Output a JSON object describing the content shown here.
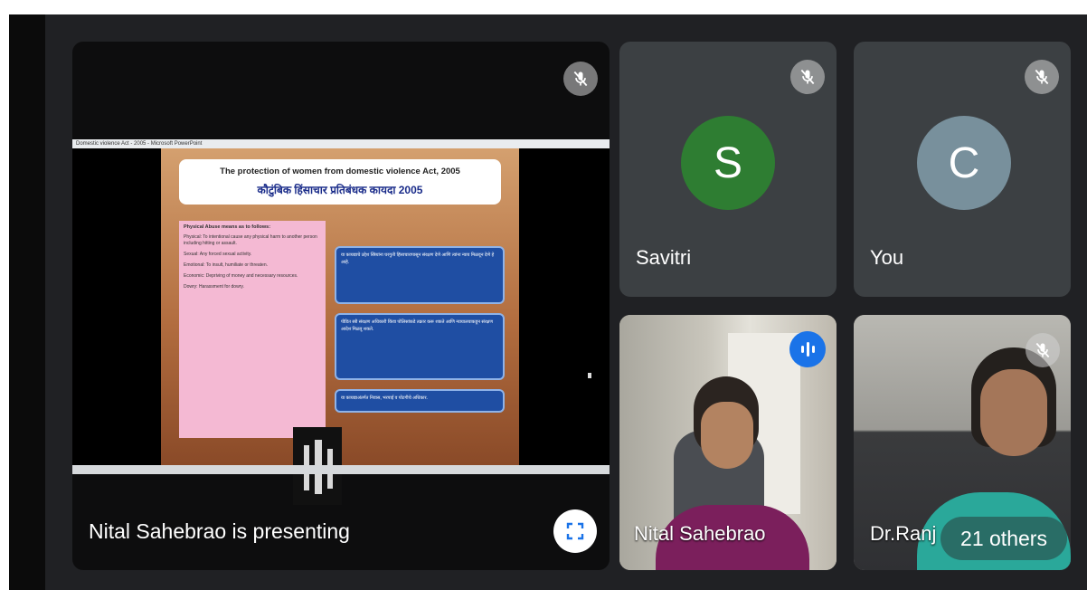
{
  "presentation": {
    "status_text": "Nital Sahebrao is presenting",
    "window_title": "Domestic violence Act - 2005 - Microsoft PowerPoint",
    "slide": {
      "title_en": "The protection of women from domestic violence Act, 2005",
      "title_mr": "कौटुंबिक हिंसाचार प्रतिबंधक कायदा 2005",
      "pink_heading": "Physical Abuse means as to follows:",
      "pink_points": [
        "Physical: To intentional cause any physical harm to another person including hitting or assault.",
        "Sexual: Any forced sexual activity.",
        "Emotional: To insult, humiliate or threaten.",
        "Economic: Depriving of money and necessary resources.",
        "Dowry: Harassment for dowry."
      ],
      "blue_boxes": [
        "या कायद्याचे उद्देश स्त्रियांना घरगुती हिंसाचारापासून संरक्षण देणे आणि त्यांना न्याय मिळवून देणे हे आहे.",
        "पीडित स्त्री संरक्षण अधिकारी किंवा पोलिसांकडे तक्रार करू शकते आणि न्यायालयाकडून संरक्षण आदेश मिळवू शकते.",
        "या कायद्याअंतर्गत निवास, भरपाई व पोटगीचे अधिकार."
      ]
    }
  },
  "participants": [
    {
      "name": "Savitri",
      "initial": "S",
      "avatar_color": "#2e7d32",
      "muted": true
    },
    {
      "name": "You",
      "initial": "C",
      "avatar_color": "#78909c",
      "muted": true
    },
    {
      "name": "Nital Sahebrao",
      "speaking": true
    },
    {
      "name": "Dr.Ranj",
      "muted": true
    }
  ],
  "others_label": "21 others",
  "colors": {
    "stage_bg": "#202124",
    "tile_bg": "#3c4043",
    "accent": "#1a73e8"
  },
  "icons": [
    "mic-off-icon",
    "fullscreen-icon",
    "audio-wave-icon"
  ]
}
